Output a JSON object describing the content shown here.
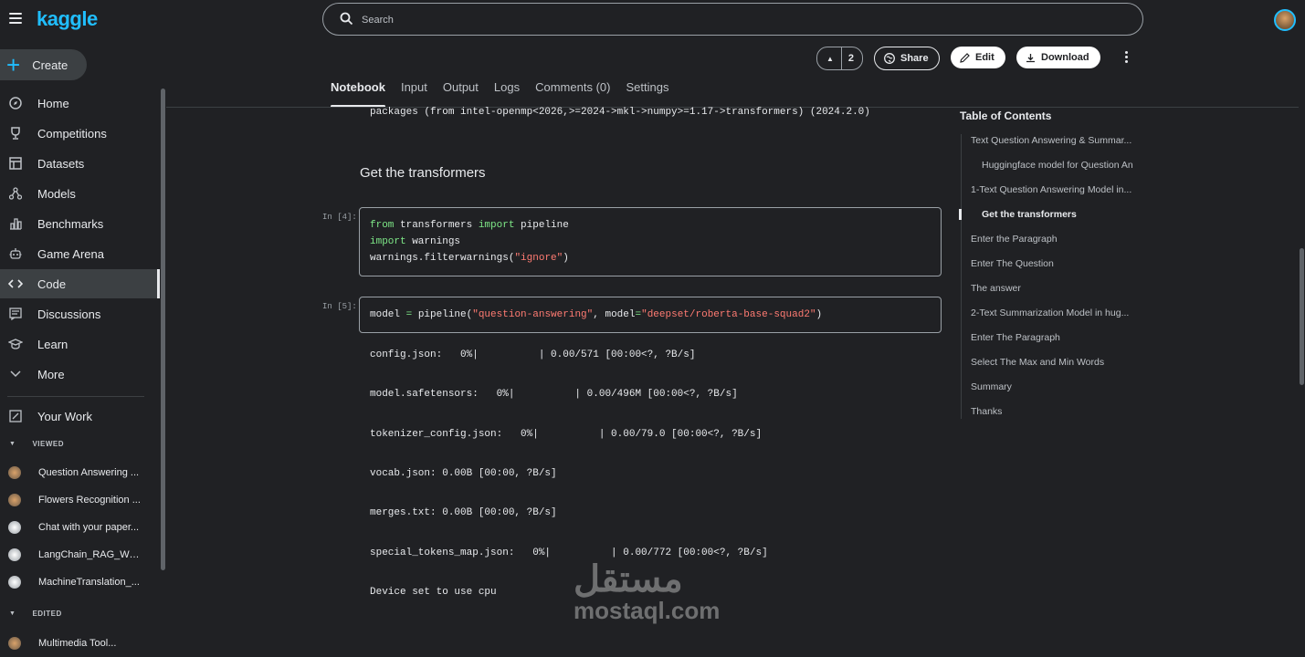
{
  "app": {
    "logo": "kaggle"
  },
  "sidebar": {
    "create_label": "Create",
    "items": [
      {
        "label": "Home",
        "icon": "compass-icon"
      },
      {
        "label": "Competitions",
        "icon": "trophy-icon"
      },
      {
        "label": "Datasets",
        "icon": "table-icon"
      },
      {
        "label": "Models",
        "icon": "models-icon"
      },
      {
        "label": "Benchmarks",
        "icon": "bar-chart-icon"
      },
      {
        "label": "Game Arena",
        "icon": "robot-icon"
      },
      {
        "label": "Code",
        "icon": "code-icon",
        "active": true
      },
      {
        "label": "Discussions",
        "icon": "discussion-icon"
      },
      {
        "label": "Learn",
        "icon": "school-icon"
      },
      {
        "label": "More",
        "icon": "chevron-down-icon"
      }
    ],
    "your_work_label": "Your Work",
    "viewed_label": "VIEWED",
    "viewed_items": [
      "Question Answering ...",
      "Flowers Recognition ...",
      "Chat with your paper...",
      "LangChain_RAG_We...",
      "MachineTranslation_..."
    ],
    "edited_label": "EDITED",
    "edited_items": [
      "Multimedia Tool..."
    ]
  },
  "header": {
    "search_placeholder": "Search",
    "vote_count": "2",
    "share_label": "Share",
    "edit_label": "Edit",
    "download_label": "Download"
  },
  "tabs": [
    "Notebook",
    "Input",
    "Output",
    "Logs",
    "Comments (0)",
    "Settings"
  ],
  "notebook": {
    "top_output": "packages (from intel-openmp<2026,>=2024->mkl->numpy>=1.17->transformers) (2024.2.0)",
    "heading": "Get the transformers",
    "cell4": {
      "label": "In [4]:",
      "l1_kw1": "from",
      "l1_mid": " transformers ",
      "l1_kw2": "import",
      "l1_end": " pipeline",
      "l2_kw": "import",
      "l2_end": " warnings",
      "l3_a": "warnings.filterwarnings(",
      "l3_str": "\"ignore\"",
      "l3_b": ")"
    },
    "cell5": {
      "label": "In [5]:",
      "a": "model ",
      "eq": "=",
      "b": " pipeline(",
      "s1": "\"question-answering\"",
      "c": ", model",
      "eq2": "=",
      "s2": "\"deepset/roberta-base-squad2\"",
      "d": ")"
    },
    "outputs": [
      "config.json:   0%|          | 0.00/571 [00:00<?, ?B/s]",
      "model.safetensors:   0%|          | 0.00/496M [00:00<?, ?B/s]",
      "tokenizer_config.json:   0%|          | 0.00/79.0 [00:00<?, ?B/s]",
      "vocab.json: 0.00B [00:00, ?B/s]",
      "merges.txt: 0.00B [00:00, ?B/s]",
      "special_tokens_map.json:   0%|          | 0.00/772 [00:00<?, ?B/s]",
      "Device set to use cpu"
    ]
  },
  "toc": {
    "title": "Table of Contents",
    "items": [
      "Text Question Answering & Summar...",
      "Huggingface model for Question An",
      "1-Text Question Answering Model in...",
      "Get the transformers",
      "Enter the Paragraph",
      "Enter The Question",
      "The answer",
      "2-Text Summarization Model in hug...",
      "Enter The Paragraph",
      "Select The Max and Min Words",
      "Summary",
      "Thanks"
    ]
  },
  "watermark": {
    "arabic": "مستقل",
    "latin": "mostaql.com"
  }
}
